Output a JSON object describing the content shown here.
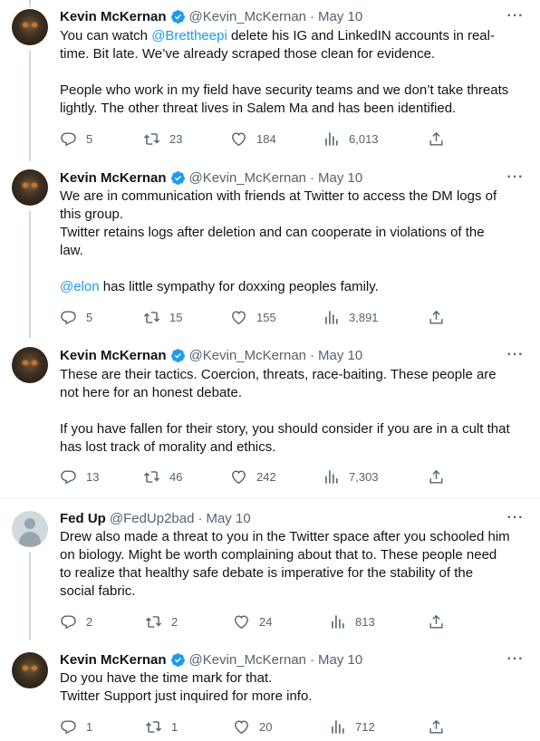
{
  "tweets": [
    {
      "author": "Kevin McKernan",
      "handle": "@Kevin_McKernan",
      "date": "May 10",
      "verified": true,
      "lines": [
        {
          "pre": "You can watch ",
          "mention": "@Brettheepi",
          "post": " delete his IG and LinkedIN accounts in real-"
        },
        {
          "text": "time. Bit late. We’ve already scraped those clean for evidence."
        },
        {
          "text": ""
        },
        {
          "text": "People who work in my field have security teams and we don’t take threats"
        },
        {
          "text": "lightly. The other threat lives in Salem Ma and has been identified."
        }
      ],
      "replies": "5",
      "retweets": "23",
      "likes": "184",
      "views": "6,013"
    },
    {
      "author": "Kevin McKernan",
      "handle": "@Kevin_McKernan",
      "date": "May 10",
      "verified": true,
      "lines": [
        {
          "text": "We are in communication with friends at Twitter to access the DM logs of"
        },
        {
          "text": "this group."
        },
        {
          "text": "Twitter retains logs after deletion and can cooperate in violations of the"
        },
        {
          "text": "law."
        },
        {
          "text": ""
        },
        {
          "pre": "",
          "mention": "@elon",
          "post": " has little sympathy for doxxing peoples family."
        }
      ],
      "replies": "5",
      "retweets": "15",
      "likes": "155",
      "views": "3,891"
    },
    {
      "author": "Kevin McKernan",
      "handle": "@Kevin_McKernan",
      "date": "May 10",
      "verified": true,
      "lines": [
        {
          "text": "These are their tactics. Coercion, threats, race-baiting. These people are"
        },
        {
          "text": "not here for an honest debate."
        },
        {
          "text": ""
        },
        {
          "text": "If you have fallen for their story, you should consider if you are in a cult that"
        },
        {
          "text": "has lost track of morality and ethics."
        }
      ],
      "replies": "13",
      "retweets": "46",
      "likes": "242",
      "views": "7,303"
    },
    {
      "author": "Fed Up",
      "handle": "@FedUp2bad",
      "date": "May 10",
      "verified": false,
      "lines": [
        {
          "text": "Drew also made a threat to you in the Twitter space after you schooled him"
        },
        {
          "text": "on biology. Might be worth complaining about that to. These people need"
        },
        {
          "text": "to realize that healthy safe debate is imperative for the stability of the"
        },
        {
          "text": "social fabric."
        }
      ],
      "replies": "2",
      "retweets": "2",
      "likes": "24",
      "views": "813"
    },
    {
      "author": "Kevin McKernan",
      "handle": "@Kevin_McKernan",
      "date": "May 10",
      "verified": true,
      "lines": [
        {
          "text": "Do you have the time mark for that."
        },
        {
          "text": "Twitter Support just inquired for more info."
        }
      ],
      "replies": "1",
      "retweets": "1",
      "likes": "20",
      "views": "712"
    }
  ],
  "colors": {
    "accent": "#1d9bf0",
    "muted": "#536471",
    "text": "#0f1419"
  },
  "icons": {
    "reply": "reply-icon",
    "retweet": "retweet-icon",
    "like": "heart-icon",
    "views": "views-icon",
    "share": "share-icon",
    "more": "more-icon",
    "verified": "verified-badge-icon"
  }
}
